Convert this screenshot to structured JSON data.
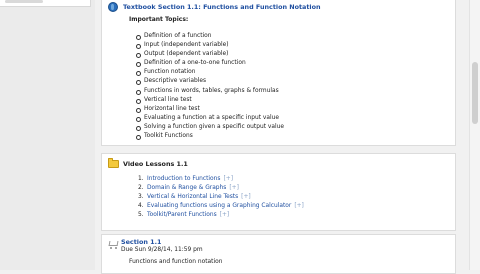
{
  "textbook_section": {
    "title": "Textbook Section 1.1: Functions and Function Notation",
    "subhead": "Important Topics:",
    "topics": [
      "Definition of a function",
      "Input (independent variable)",
      "Output (dependent variable)",
      "Definition of a one-to-one function",
      "Function notation",
      "Descriptive variables",
      "Functions in words, tables, graphs & formulas",
      "Vertical line test",
      "Horizontal line test",
      "Evaluating a function at a specific input value",
      "Solving a function given a specific output value",
      "Toolkit Functions"
    ]
  },
  "video_lessons": {
    "title": "Video Lessons 1.1",
    "items": [
      {
        "num": "1.",
        "label": "Introduction to Functions",
        "plus": "[+]"
      },
      {
        "num": "2.",
        "label": "Domain & Range & Graphs",
        "plus": "[+]"
      },
      {
        "num": "3.",
        "label": "Vertical & Horizontal Line Tests",
        "plus": "[+]"
      },
      {
        "num": "4.",
        "label": "Evaluating functions using a Graphing Calculator",
        "plus": "[+]"
      },
      {
        "num": "5.",
        "label": "Toolkit/Parent Functions",
        "plus": "[+]"
      }
    ]
  },
  "assignment": {
    "title": "Section 1.1",
    "due": "Due Sun 9/28/14, 11:59 pm",
    "description": "Functions and function notation"
  },
  "colors": {
    "link": "#1f4fa0",
    "card_border": "#dcdcdc",
    "page_bg": "#f1f1f1"
  }
}
